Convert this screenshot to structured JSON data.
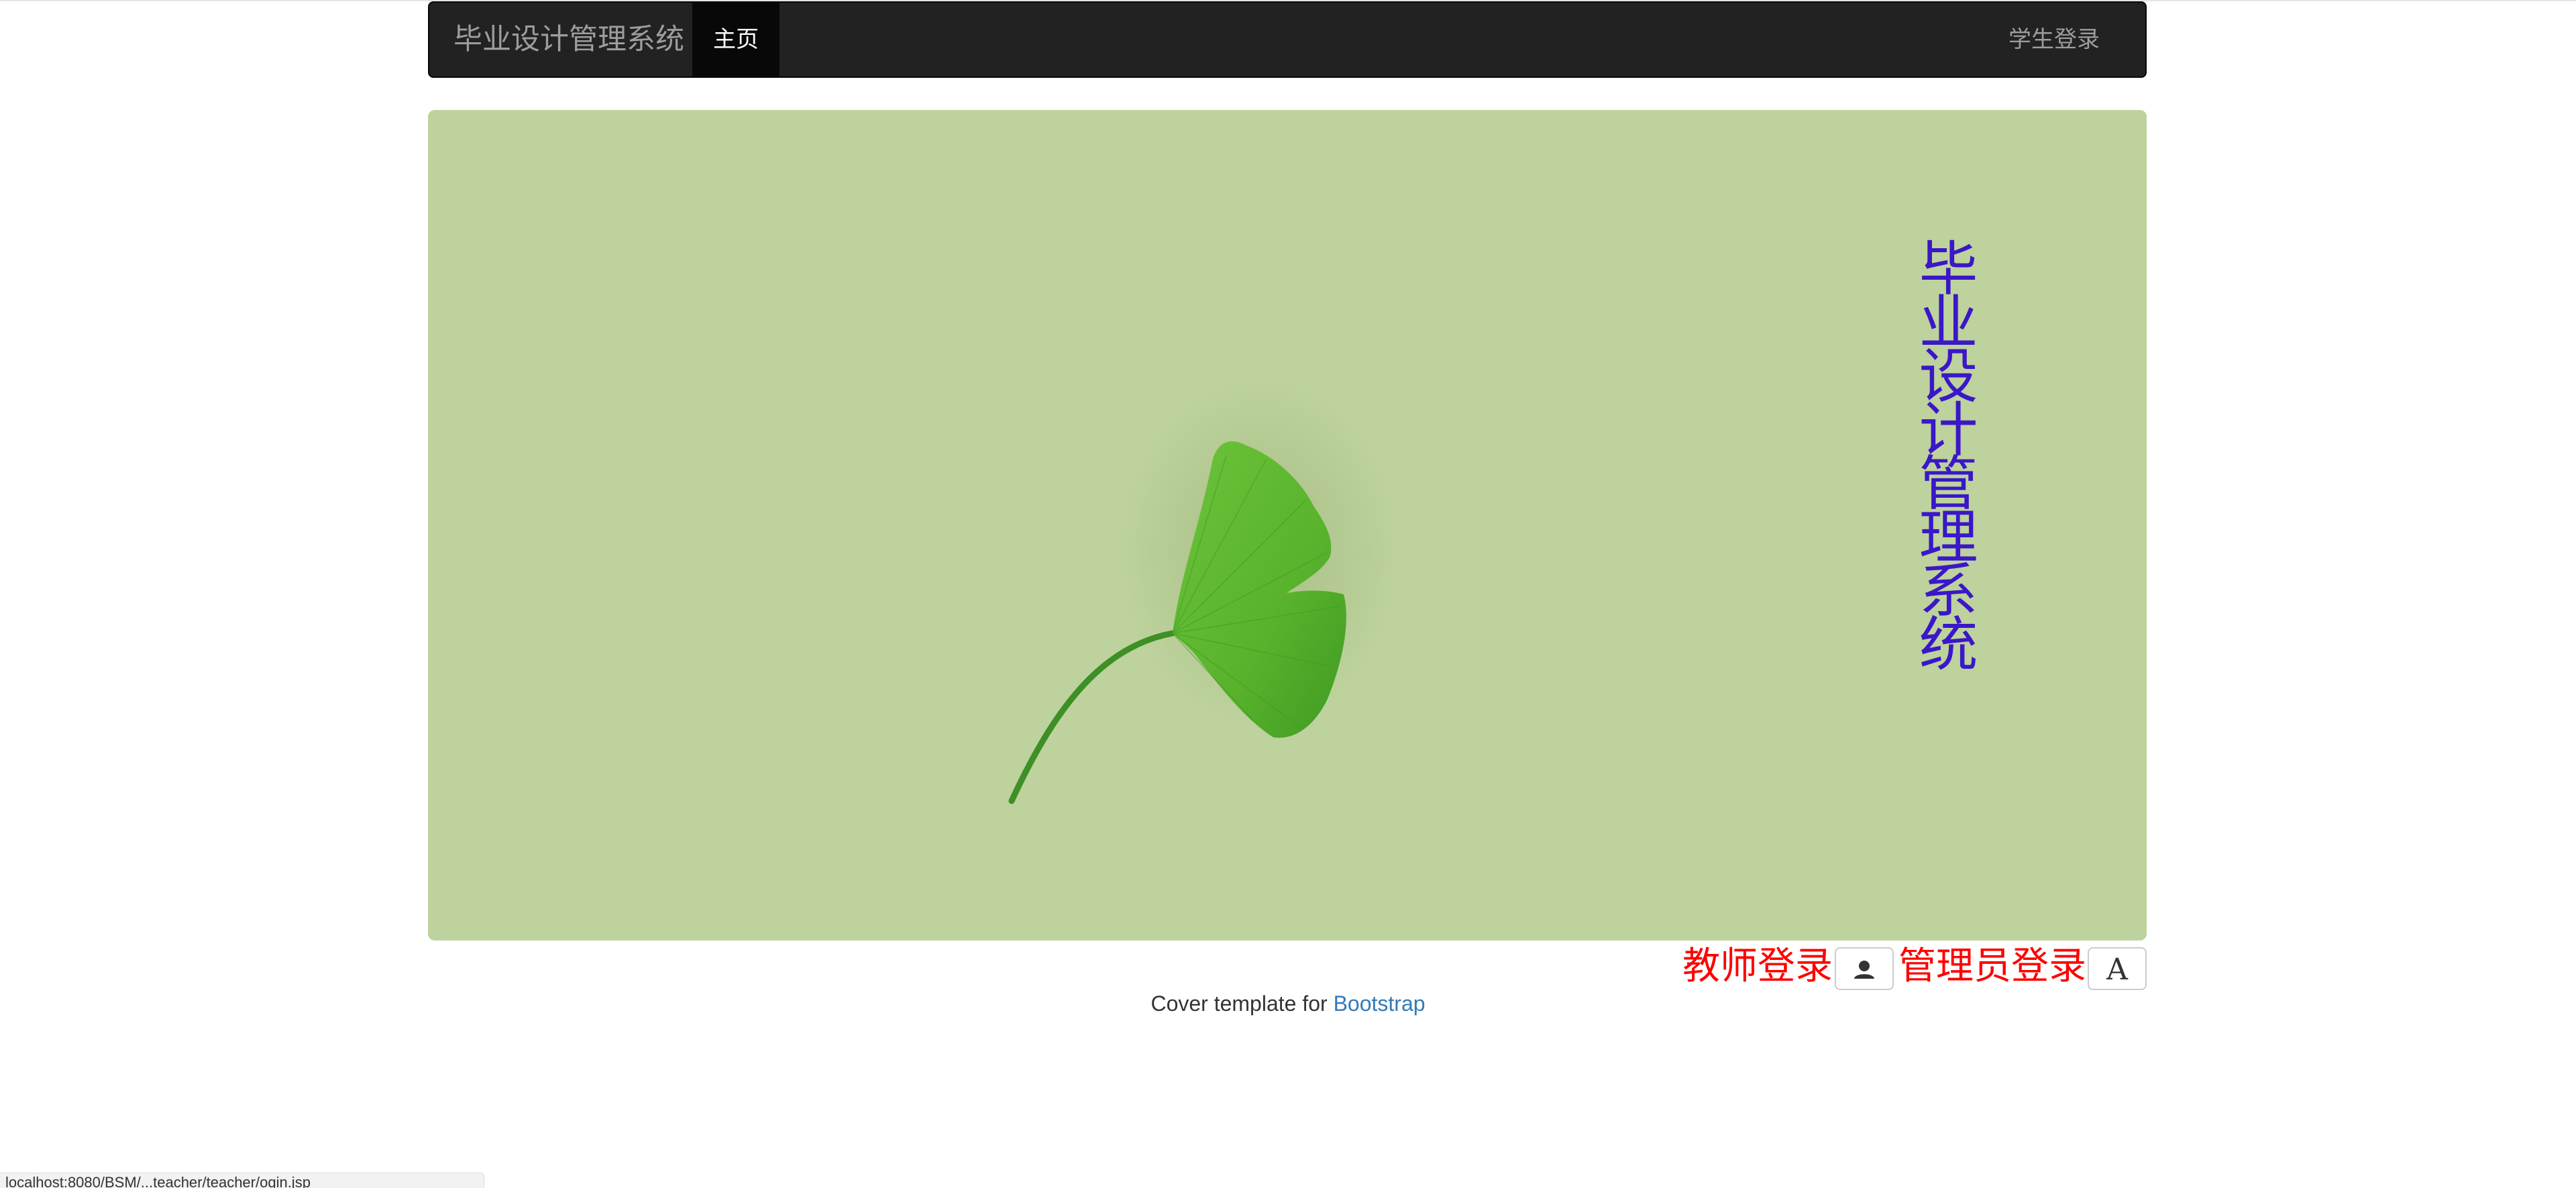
{
  "navbar": {
    "brand": "毕业设计管理系统",
    "home_label": "主页",
    "student_login_label": "学生登录"
  },
  "hero": {
    "vertical_title": "毕业设计管理系统",
    "background_color": "#bdd29c",
    "title_color": "#3a17c8",
    "image": "ginkgo-leaf"
  },
  "logins": {
    "teacher_label": "教师登录",
    "teacher_icon": "user-icon",
    "admin_label": "管理员登录",
    "admin_icon_glyph": "A"
  },
  "footer": {
    "text_prefix": "Cover template for ",
    "link_text": "Bootstrap"
  },
  "status_bar": {
    "url": "localhost:8080/BSM/...teacher/teacher/ogin.jsp"
  }
}
